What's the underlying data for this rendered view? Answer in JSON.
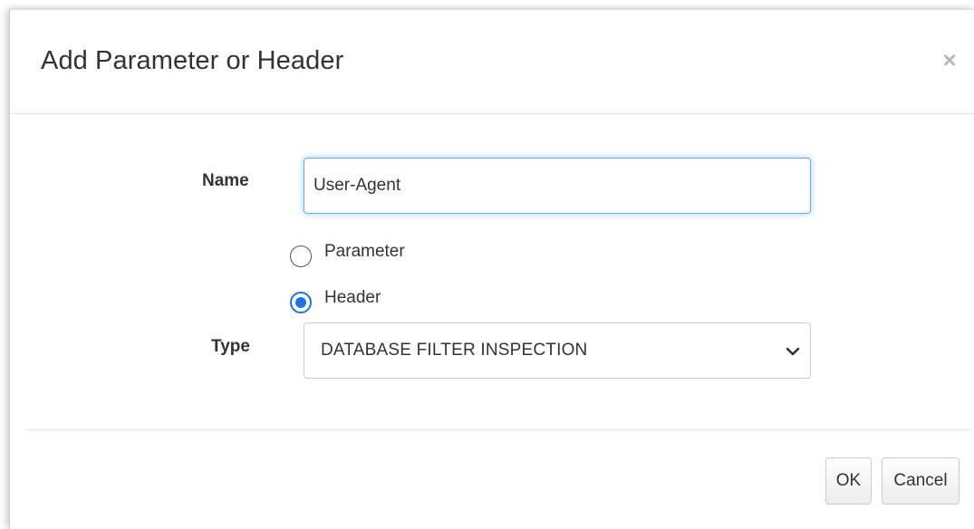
{
  "dialog": {
    "title": "Add Parameter or Header",
    "close_glyph": "×"
  },
  "form": {
    "name_label": "Name",
    "name_value": "User-Agent",
    "options": [
      {
        "label": "Parameter",
        "checked": false
      },
      {
        "label": "Header",
        "checked": true
      }
    ],
    "type_label": "Type",
    "type_value": "DATABASE FILTER INSPECTION"
  },
  "footer": {
    "ok_label": "OK",
    "cancel_label": "Cancel"
  },
  "colors": {
    "accent": "#1a73e8",
    "focus_border": "#66afe9",
    "text": "#333333"
  },
  "icons": {
    "close": "close-icon",
    "select": "chevron-down-icon"
  }
}
